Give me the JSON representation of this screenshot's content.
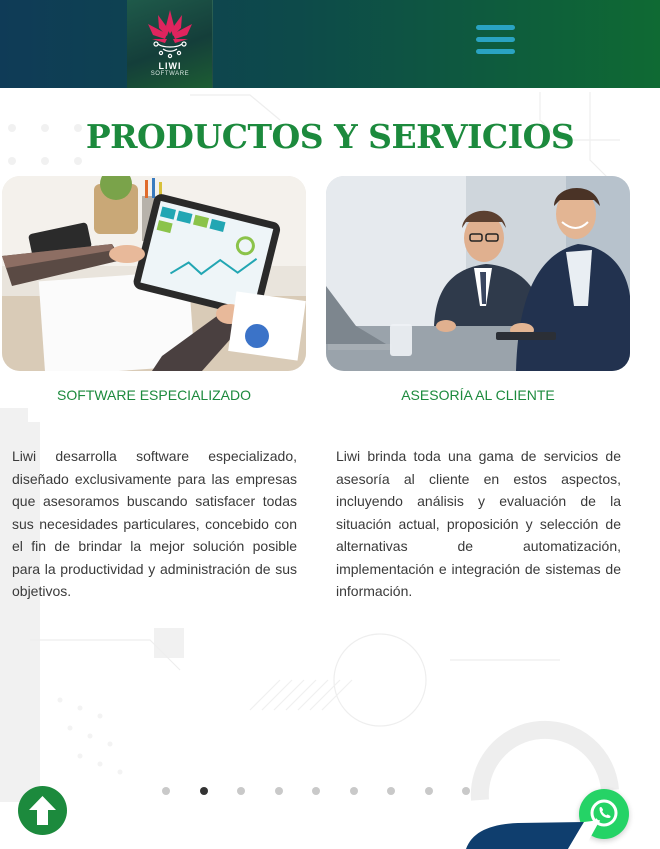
{
  "header": {
    "logo_name": "LIWI",
    "logo_sub": "SOFTWARE",
    "menu_icon": "hamburger-menu-icon"
  },
  "section": {
    "title": "PRODUCTOS Y SERVICIOS"
  },
  "cards": [
    {
      "title": "SOFTWARE ESPECIALIZADO",
      "description": "Liwi desarrolla software especializado, diseñado exclusivamente para las empresas que asesoramos buscando satisfacer todas sus necesidades particulares, concebido con el fin de brindar la mejor solución posible para la productividad y administración de sus objetivos."
    },
    {
      "title": "ASESORÍA AL CLIENTE",
      "description": "Liwi brinda toda una gama de servicios de asesoría al cliente en estos aspectos, incluyendo análisis y evaluación de la situación actual, proposición y selección de alternativas de automatización, implementación e integración de sistemas de información."
    }
  ],
  "carousel": {
    "count": 9,
    "active_index": 1
  },
  "colors": {
    "brand_green": "#1c8a3d",
    "menu_blue": "#2aa3c2",
    "whatsapp_green": "#25d366",
    "header_start": "#0f3b57",
    "header_end": "#0f6a33"
  },
  "icons": {
    "scroll_top": "arrow-up-icon",
    "chat": "whatsapp-icon"
  }
}
